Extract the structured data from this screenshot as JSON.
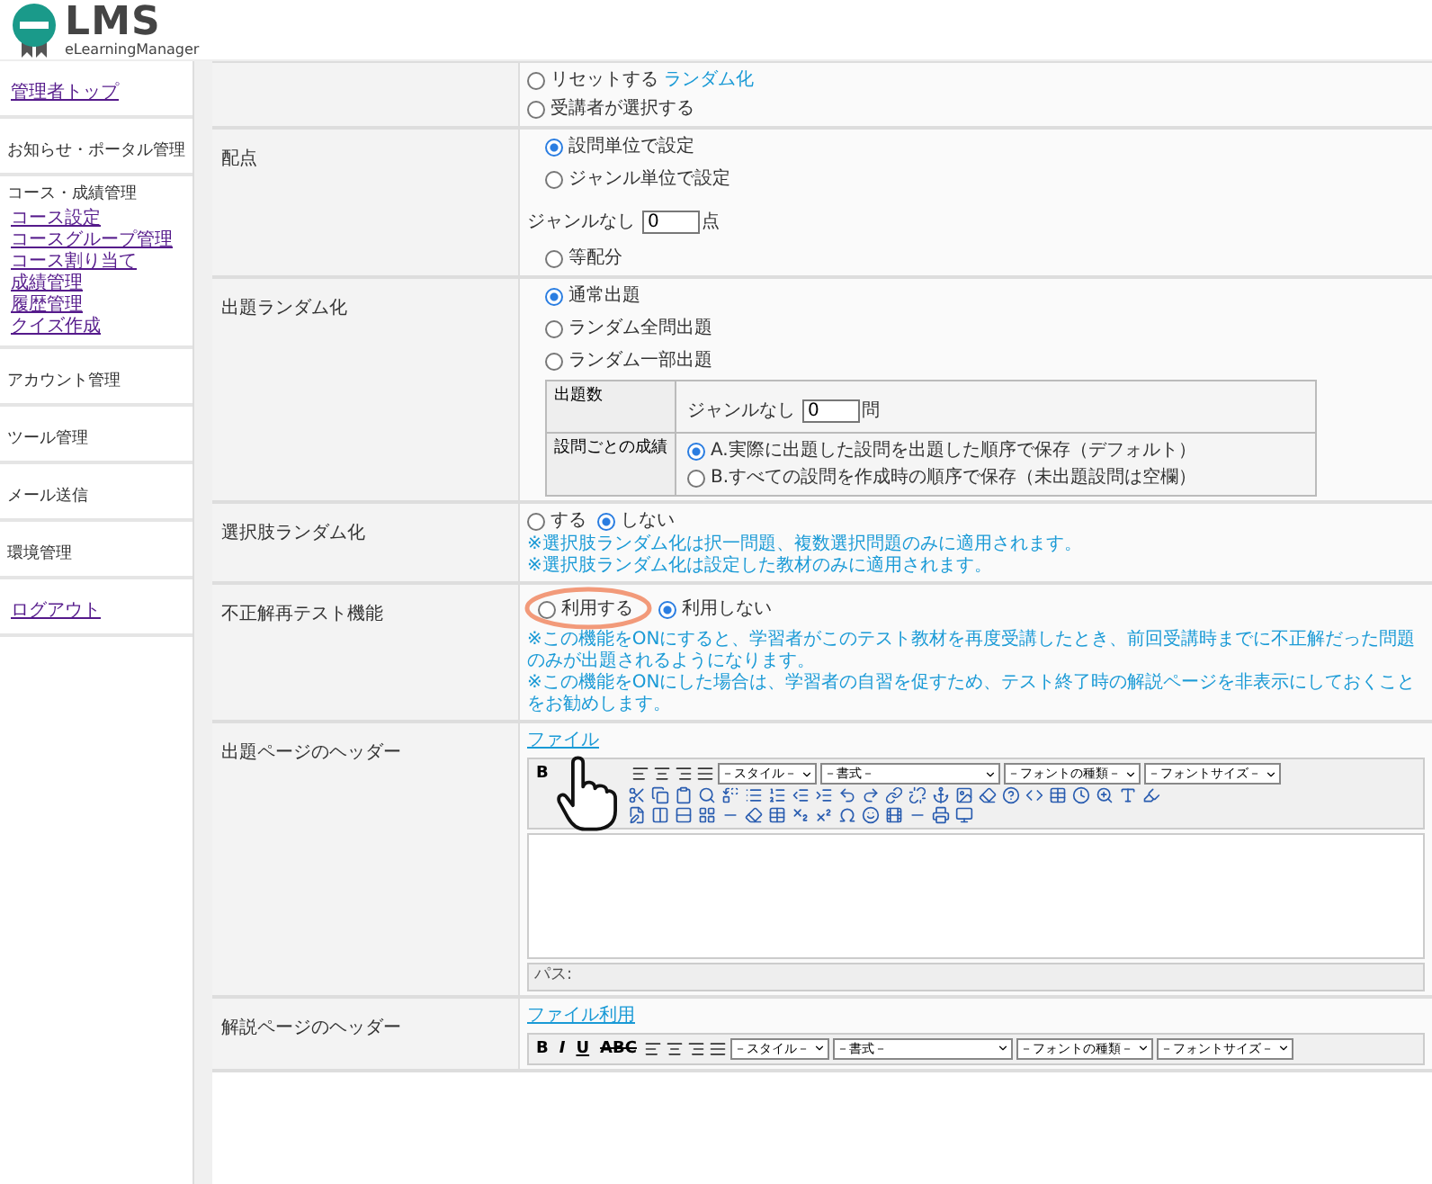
{
  "logo": {
    "title": "LMS",
    "subtitle": "eLearningManager"
  },
  "sidebar": {
    "items": [
      {
        "kind": "link",
        "label": "管理者トップ"
      },
      {
        "kind": "heading",
        "label": "お知らせ・ポータル管理"
      },
      {
        "kind": "group",
        "label": "コース・成績管理",
        "children": [
          {
            "label": "コース設定"
          },
          {
            "label": "コースグループ管理"
          },
          {
            "label": "コース割り当て"
          },
          {
            "label": "成績管理"
          },
          {
            "label": "履歴管理"
          },
          {
            "label": "クイズ作成"
          }
        ]
      },
      {
        "kind": "heading",
        "label": "アカウント管理"
      },
      {
        "kind": "heading",
        "label": "ツール管理"
      },
      {
        "kind": "heading",
        "label": "メール送信"
      },
      {
        "kind": "heading",
        "label": "環境管理"
      },
      {
        "kind": "link",
        "label": "ログアウト"
      }
    ]
  },
  "form": {
    "rows": [
      {
        "kind": "radios",
        "options": [
          {
            "label": "リセットする",
            "link": "ランダム化",
            "selected": false
          },
          {
            "label": "受講者が選択する",
            "selected": false
          }
        ]
      },
      {
        "kind": "scoring",
        "label": "配点",
        "options": [
          {
            "label": "設問単位で設定",
            "selected": true
          },
          {
            "label": "ジャンル単位で設定",
            "selected": false,
            "field": {
              "label": "ジャンルなし",
              "value": "0",
              "unit": "点"
            }
          },
          {
            "label": "等配分",
            "selected": false
          }
        ]
      },
      {
        "kind": "random",
        "label": "出題ランダム化",
        "options": [
          {
            "label": "通常出題",
            "selected": true
          },
          {
            "label": "ランダム全問出題",
            "selected": false
          },
          {
            "label": "ランダム一部出題",
            "selected": false
          }
        ],
        "subtable": {
          "count_label": "出題数",
          "count_field": {
            "label": "ジャンルなし",
            "value": "0",
            "unit": "問"
          },
          "score_label": "設問ごとの成績",
          "score_options": [
            {
              "label": "A.実際に出題した設問を出題した順序で保存（デフォルト）",
              "selected": true
            },
            {
              "label": "B.すべての設問を作成時の順序で保存（未出題設問は空欄）",
              "selected": false
            }
          ]
        }
      },
      {
        "kind": "inline",
        "label": "選択肢ランダム化",
        "options": [
          {
            "label": "する",
            "selected": false
          },
          {
            "label": "しない",
            "selected": true
          }
        ],
        "notes": [
          "※選択肢ランダム化は択一問題、複数選択問題のみに適用されます。",
          "※選択肢ランダム化は設定した教材のみに適用されます。"
        ]
      },
      {
        "kind": "inline",
        "label": "不正解再テスト機能",
        "highlighted": true,
        "options": [
          {
            "label": "利用する",
            "selected": false
          },
          {
            "label": "利用しない",
            "selected": true
          }
        ],
        "notes": [
          "※この機能をONにすると、学習者がこのテスト教材を再度受講したとき、前回受講時までに不正解だった問題のみが出題されるようになります。",
          "※この機能をONにした場合は、学習者の自習を促すため、テスト終了時の解説ページを非表示にしておくことをお勧めします。"
        ]
      },
      {
        "kind": "editor",
        "label": "出題ページのヘッダー",
        "link": "ファイル",
        "cursor": true,
        "full": true,
        "buttons": [
          {
            "kind": "bold",
            "label": "B"
          }
        ],
        "selects": [
          "－スタイル－",
          "－書式－",
          "－フォントの種類－",
          "－フォントサイズ－"
        ],
        "path": "パス:"
      },
      {
        "kind": "editor",
        "label": "解説ページのヘッダー",
        "link": "ファイル利用",
        "cursor": false,
        "full": false,
        "buttons": [
          {
            "kind": "bold",
            "label": "B"
          },
          {
            "kind": "italic",
            "label": "I"
          },
          {
            "kind": "underline",
            "label": "U"
          },
          {
            "kind": "strike",
            "label": "ABC"
          }
        ],
        "selects": [
          "－スタイル－",
          "－書式－",
          "－フォントの種類－",
          "－フォントサイズ－"
        ]
      }
    ]
  }
}
